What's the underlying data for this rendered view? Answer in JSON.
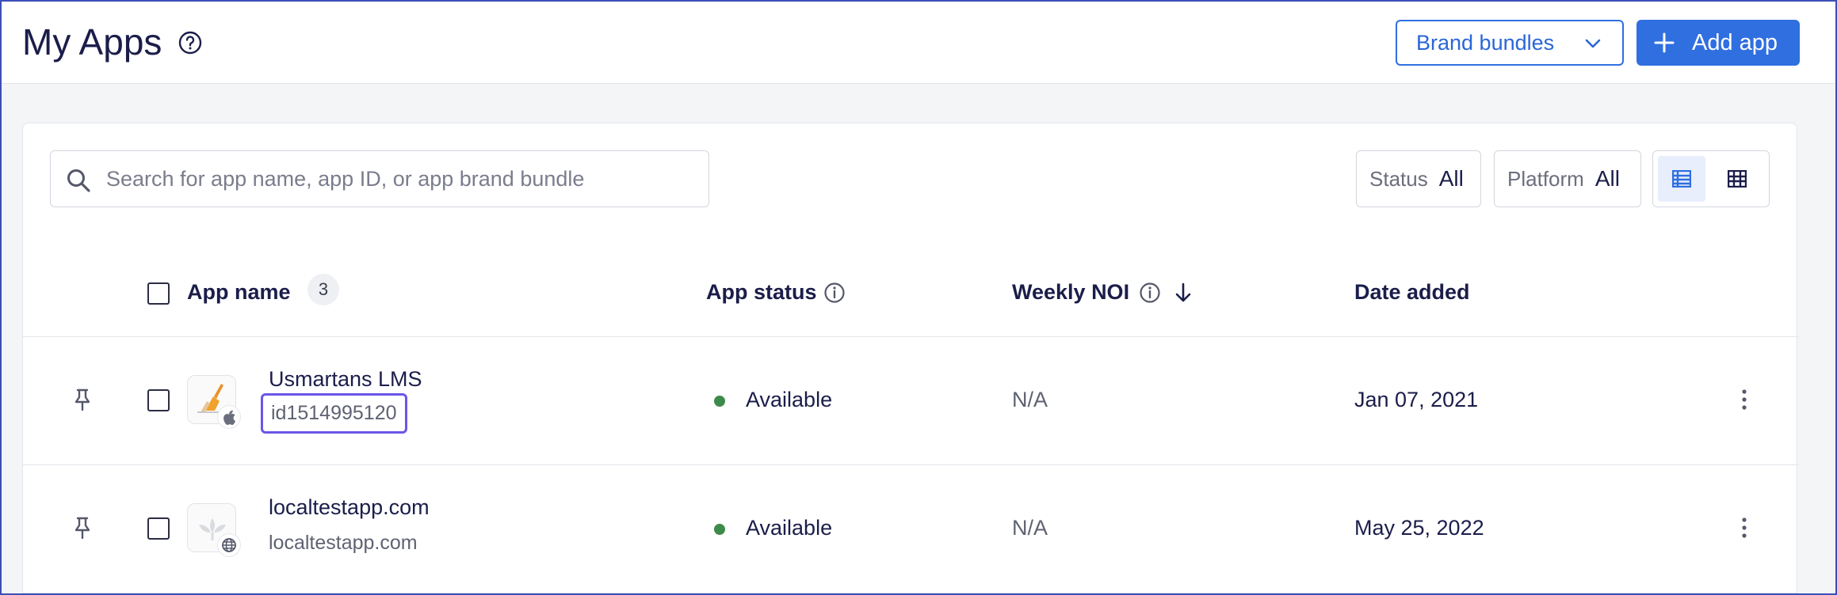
{
  "header": {
    "title": "My Apps",
    "brand_bundles_label": "Brand bundles",
    "add_app_label": "Add app"
  },
  "toolbar": {
    "search_placeholder": "Search for app name, app ID, or app brand bundle",
    "status_label": "Status",
    "status_value": "All",
    "platform_label": "Platform",
    "platform_value": "All"
  },
  "table": {
    "columns": {
      "app_name": "App name",
      "count": "3",
      "app_status": "App status",
      "weekly_noi": "Weekly NOI",
      "date_added": "Date added"
    },
    "rows": [
      {
        "name": "Usmartans LMS",
        "sub": "id1514995120",
        "platform_icon": "apple-icon",
        "status": "Available",
        "noi": "N/A",
        "date": "Jan 07, 2021"
      },
      {
        "name": "localtestapp.com",
        "sub": "localtestapp.com",
        "platform_icon": "globe-icon",
        "status": "Available",
        "noi": "N/A",
        "date": "May 25, 2022"
      }
    ]
  },
  "colors": {
    "accent": "#2f6fe0",
    "status_available": "#3d8a4a",
    "focus_ring": "#6a56e8",
    "text_primary": "#1b1d4a"
  }
}
